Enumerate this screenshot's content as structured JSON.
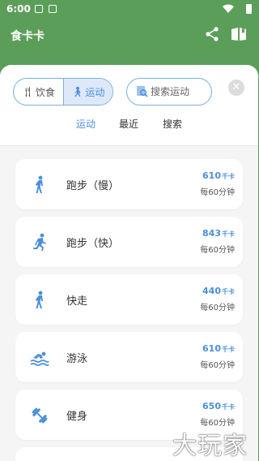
{
  "status": {
    "time": "6:00"
  },
  "header": {
    "title": "食卡卡"
  },
  "filters": {
    "seg_food": "饮食",
    "seg_sport": "运动",
    "search_placeholder": "搜索运动"
  },
  "tabs": [
    {
      "label": "运动"
    },
    {
      "label": "最近"
    },
    {
      "label": "搜索"
    }
  ],
  "exercises": [
    {
      "name": "跑步（慢）",
      "calories": "610",
      "unit": "千卡",
      "per": "每60分钟",
      "icon": "walking-icon"
    },
    {
      "name": "跑步（快）",
      "calories": "843",
      "unit": "千卡",
      "per": "每60分钟",
      "icon": "running-icon"
    },
    {
      "name": "快走",
      "calories": "440",
      "unit": "千卡",
      "per": "每60分钟",
      "icon": "walking-icon"
    },
    {
      "name": "游泳",
      "calories": "610",
      "unit": "千卡",
      "per": "每60分钟",
      "icon": "swimming-icon"
    },
    {
      "name": "健身",
      "calories": "650",
      "unit": "千卡",
      "per": "每60分钟",
      "icon": "dumbbell-icon"
    }
  ],
  "watermark": "大玩家",
  "colors": {
    "primary_green": "#5b9e59",
    "accent_blue": "#4a8fdc"
  }
}
